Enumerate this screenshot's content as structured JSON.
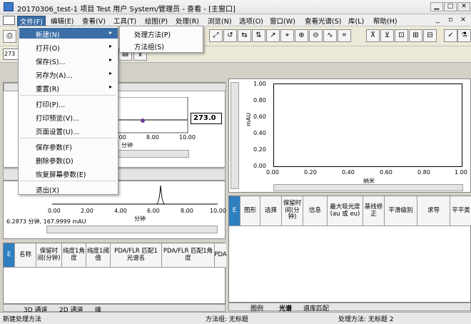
{
  "window": {
    "title": "20170306_test-1 项目 Test 用户 System/管理员 - 查看 - [主窗口]"
  },
  "menu": [
    "文件(F)",
    "编辑(E)",
    "查看(V)",
    "工具(T)",
    "绘图(P)",
    "处理(R)",
    "浏览(N)",
    "选项(O)",
    "窗口(W)",
    "查看光谱(S)",
    "库(L)",
    "帮助(H)"
  ],
  "file_menu": {
    "items": [
      {
        "label": "新建(N)",
        "arrow": "▸"
      },
      {
        "label": "打开(O)",
        "arrow": "▸"
      },
      {
        "label": "保存(S)...",
        "arrow": "▸"
      },
      {
        "label": "另存为(A)...",
        "arrow": "▸"
      },
      {
        "label": "重置(R)",
        "arrow": "▸"
      },
      {
        "label": "打印(P)..."
      },
      {
        "label": "打印预览(V)..."
      },
      {
        "label": "页面设置(U)..."
      },
      {
        "label": "保存参数(F)"
      },
      {
        "label": "删除参数(D)"
      },
      {
        "label": "恢复屏幕参数(E)"
      },
      {
        "label": "退出(X)"
      }
    ]
  },
  "new_submenu": [
    "处理方法(P)",
    "方法组(S)"
  ],
  "left_panel": {
    "field_prefix": "273",
    "wavelength_box": "273.0",
    "xticks_top": [
      "6.00",
      "8.00",
      "10.00"
    ],
    "xunit_top": "分钟",
    "xticks_bottom": [
      "0.00",
      "2.00",
      "4.00",
      "6.00",
      "8.00",
      "10.00"
    ],
    "xunit_bottom": "分钟",
    "readout": "6.2873 分钟, 167.9999 mAU"
  },
  "right_panel": {
    "yticks": [
      "1.00",
      "0.80",
      "0.60",
      "0.40",
      "0.20",
      "0.00"
    ],
    "ylabel": "mAU",
    "xticks": [
      "0.00",
      "0.20",
      "0.40",
      "0.60",
      "0.80",
      "1.00"
    ],
    "xlabel": "纳米"
  },
  "left_table": {
    "headers": [
      "名称",
      "保留时间(分钟)",
      "纯度1角度",
      "纯度1阈值",
      "PDA/FLR 匹配1光谱名",
      "PDA/FLR 匹配1角度",
      "PDA"
    ],
    "tabs": [
      "3D 通道",
      "2D 通道",
      "峰"
    ]
  },
  "right_table": {
    "headers": [
      "图形",
      "选择",
      "保留时间(分钟)",
      "信息",
      "最大吸光度(au 或 eu)",
      "基线修正",
      "平滑级别",
      "求导",
      "平平类"
    ],
    "tabs": [
      "图例",
      "光谱",
      "谱库匹配"
    ]
  },
  "status": {
    "left": "新建处理方法",
    "mid": "方法组: 无标题",
    "right": "处理方法: 无标题 2"
  }
}
